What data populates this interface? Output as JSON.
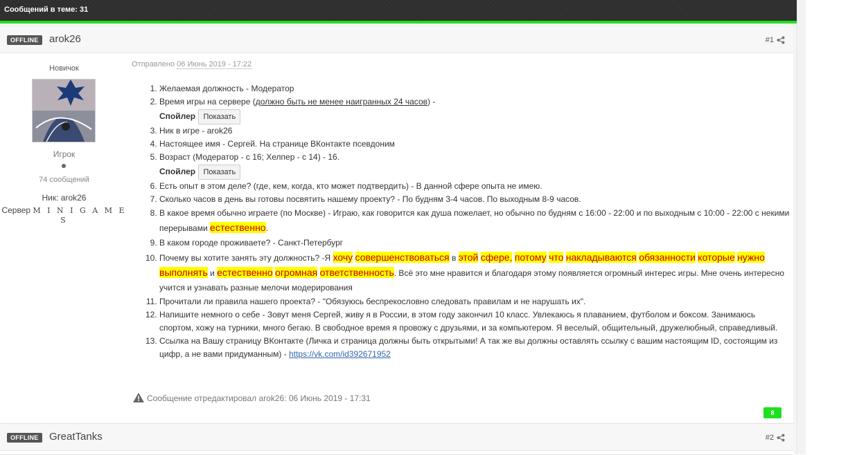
{
  "topbar": {
    "text": "Сообщений в теме: 31"
  },
  "posts": [
    {
      "status": "OFFLINE",
      "author": "arok26",
      "number": "#1",
      "sidebar": {
        "rank": "Новичок",
        "group": "Игрок",
        "messages": "74 сообщений",
        "nick": "Ник: arok26",
        "server_label": "Сервер",
        "server_name": "M I N I G A M E S"
      },
      "sent_label": "Отправлено",
      "sent_date": "06 Июнь 2019 - 17:22",
      "items": {
        "i1": "Желаемая должность - Модератор",
        "i2a": "Время игры на сервере (",
        "i2b": "должно быть не менее наигранных 24 часов",
        "i2c": ") -",
        "spoiler_label": "Спойлер",
        "spoiler_button": "Показать",
        "i3": "Ник в игре - arok26",
        "i4": "Настоящее имя -  Сергей. На странице ВКонтакте псевдоним",
        "i5": "Возраст  (Модератор - с 16; Хелпер - с 14) - 16.",
        "i6": "Есть опыт в этом деле? (где, кем, когда, кто может подтвердить) - В данной сфере опыта не имею.",
        "i7": "Сколько часов в день вы готовы посвятить нашему проекту? - По будням 3-4 часов. По выходным 8-9 часов.",
        "i8a": "В какое время обычно играете (по Москве) -  Играю, как говорится как душа пожелает, но обычно по будням с 16:00 - 22:00 и по выходным с 10:00 - 22:00 с некими перерывами ",
        "i8b": "естественно",
        "i8c": ".",
        "i9": "В каком городе проживаете? - Санкт-Петербург",
        "i10a": "Почему вы хотите занять эту должность? -Я ",
        "i10h1": "хочу",
        "i10h2": "совершенствоваться",
        "i10t1": " в ",
        "i10h3": "этой",
        "i10h4": "сфере,",
        "i10h5": "потому",
        "i10h6": "что",
        "i10h7": "накладываются",
        "i10h8": "обязанности",
        "i10h9": "которые",
        "i10h10": "нужно",
        "i10h11": "выполнять",
        "i10t2": " и ",
        "i10h12": "естественно",
        "i10h13": "огромная",
        "i10h14": "ответственность",
        "i10b": ". Всё это мне нравится и благодаря этому появляется огромный интерес игры. Мне очень интересно учится и узнавать разные мелочи модерирования",
        "i11": "Прочитали ли правила нашего проекта? -  \"Обязуюсь беспрекословно следовать правилам и не нарушать их\".",
        "i12": "Напишите немного о себе - Зовут меня Сергей, живу я в России, в этом году закончил 10 класс. Увлекаюсь я плаванием, футболом и боксом. Занимаюсь спортом, хожу на турники, много бегаю. В свободное время я провожу с друзьями, и за компьютером. Я веселый, общительный, дружелюбный, справедливый.",
        "i13a": "Ссылка на Вашу страницу ВКонтакте (Личка и страница должны быть открытыми! А так же вы должны оставлять ссылку с вашим настоящим ID, состоящим из цифр, а не вами придуманным) - ",
        "i13link": "https://vk.com/id392671952"
      },
      "edited": "Сообщение отредактировал arok26: 06 Июнь 2019 - 17:31",
      "reputation": "8"
    },
    {
      "status": "OFFLINE",
      "author": "GreatTanks",
      "number": "#2"
    }
  ],
  "colors": {
    "accent_green": "#1fe01f",
    "highlight": "#ffff00",
    "highlight_text": "#cc0000",
    "link": "#3366aa"
  }
}
